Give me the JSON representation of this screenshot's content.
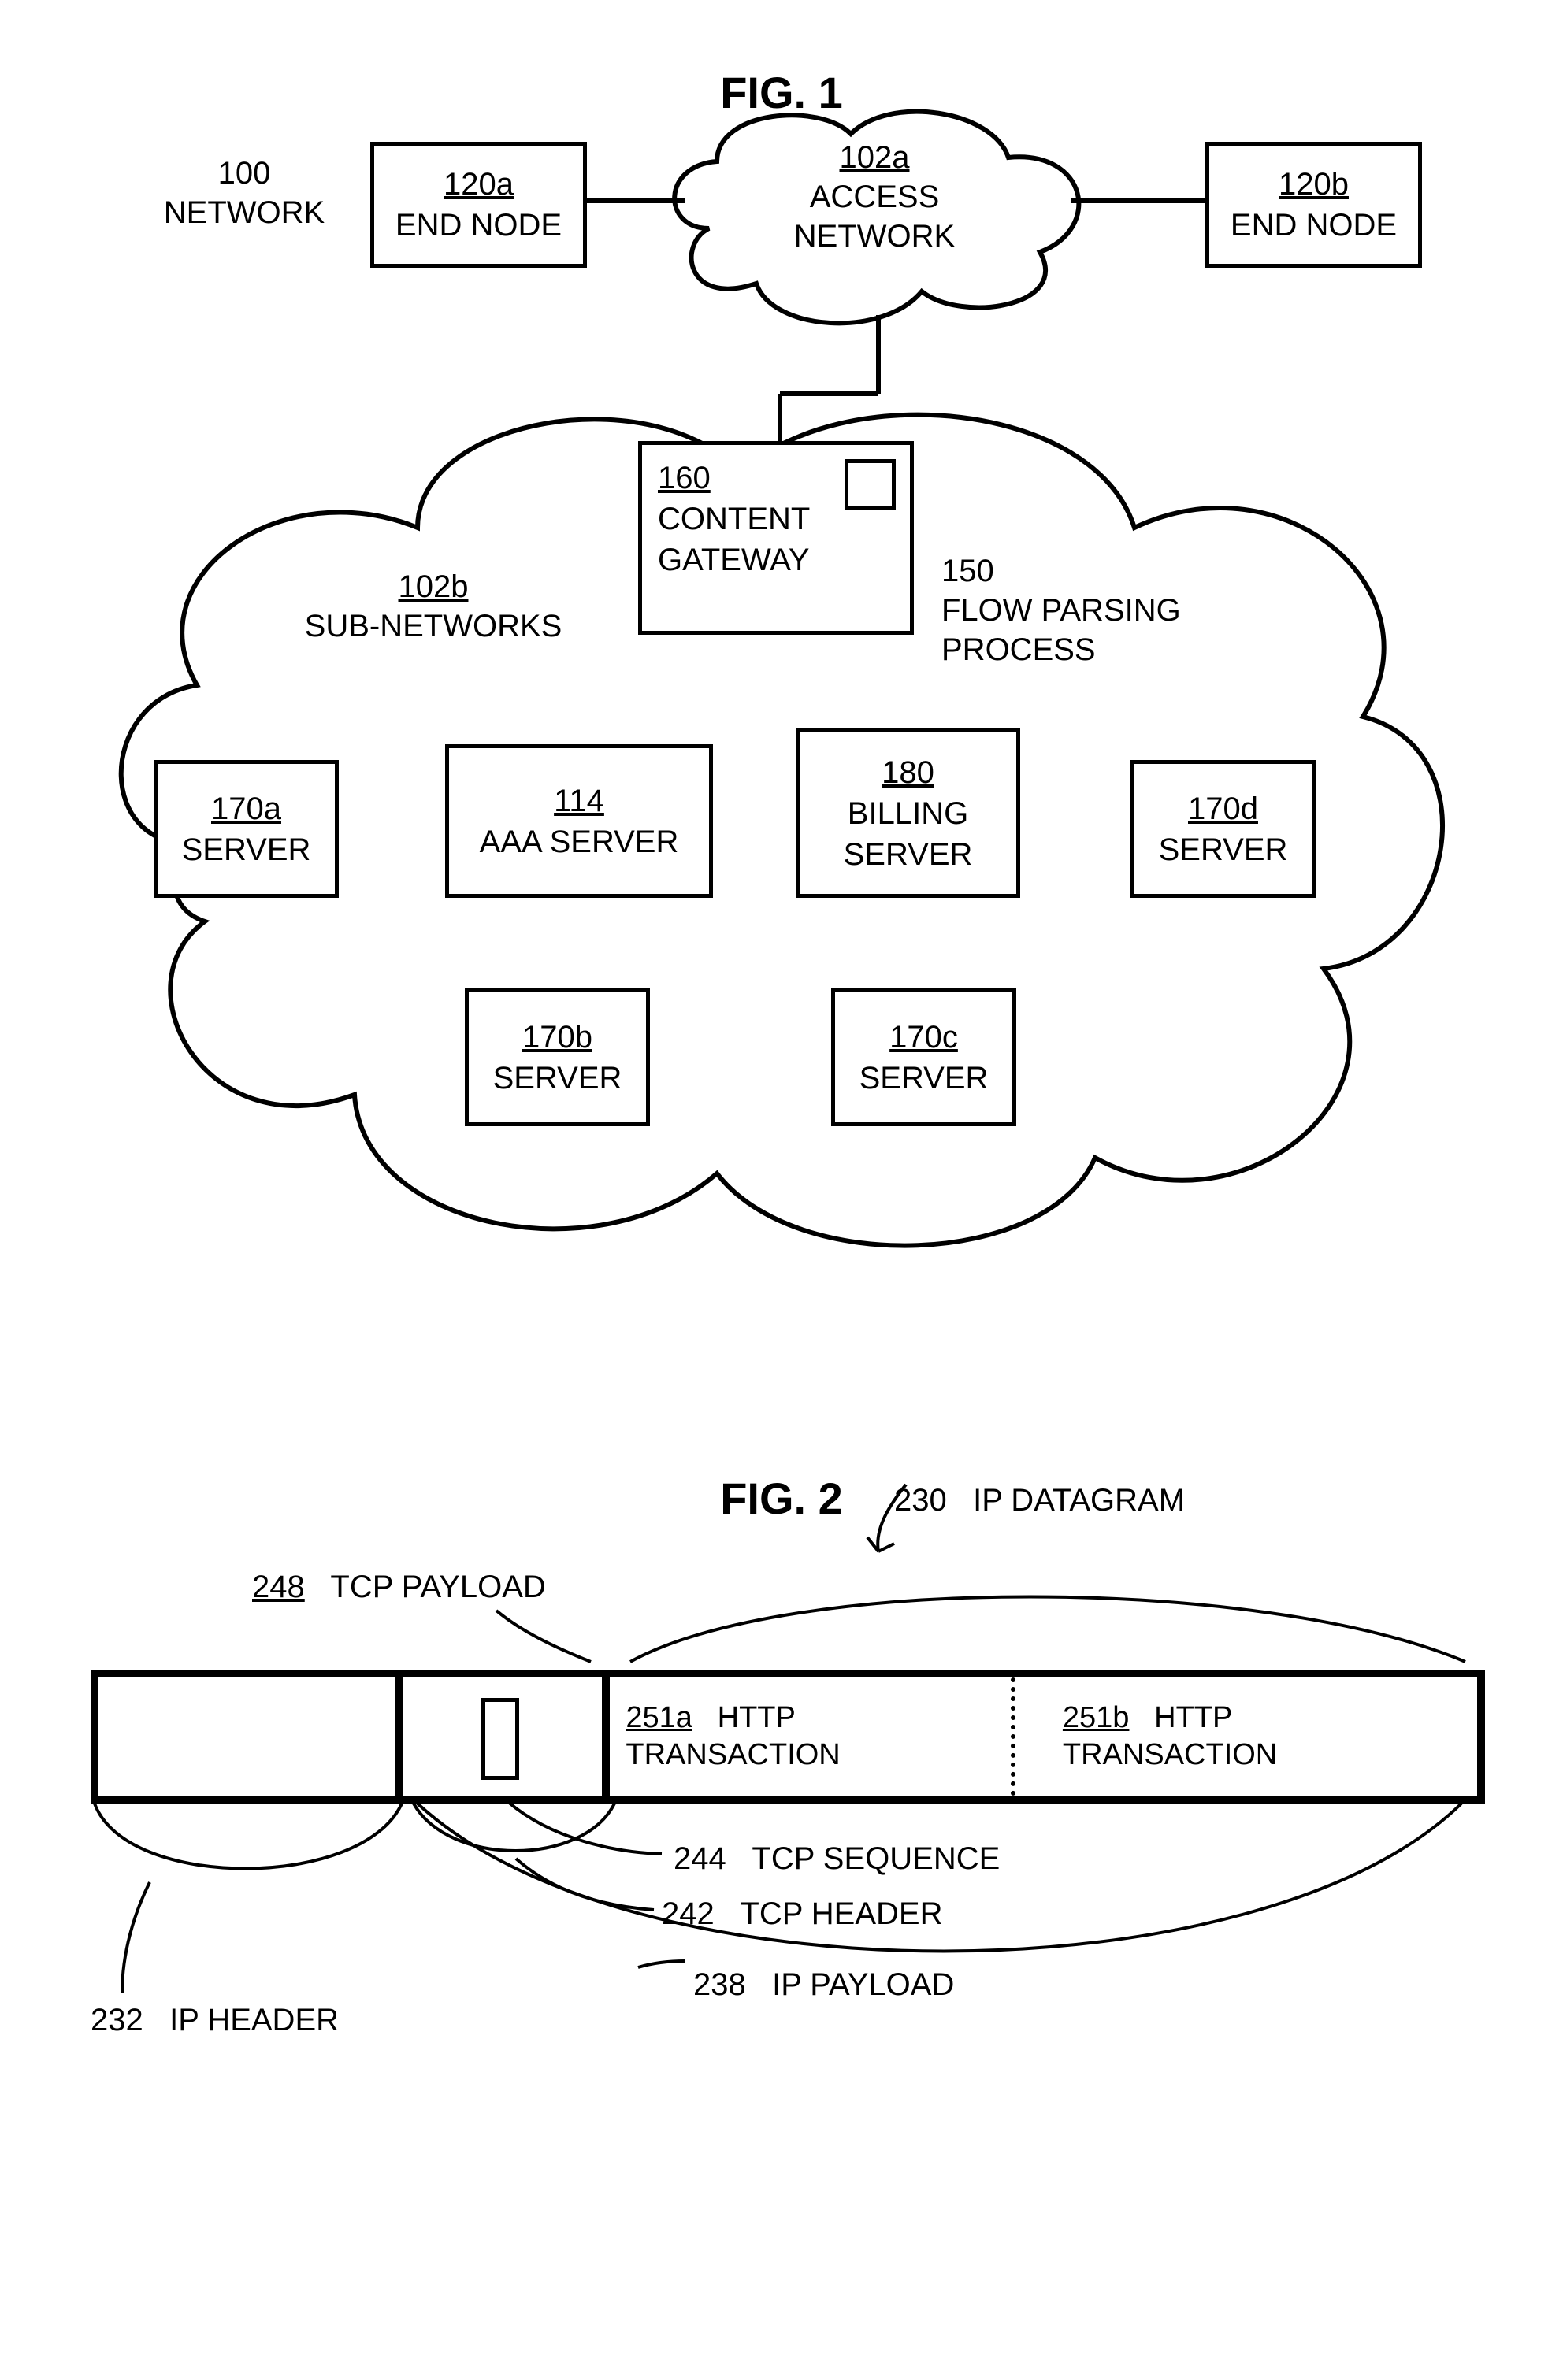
{
  "fig1": {
    "title": "FIG. 1",
    "network": {
      "id": "100",
      "label": "NETWORK"
    },
    "end_node_a": {
      "id": "120a",
      "label": "END NODE"
    },
    "end_node_b": {
      "id": "120b",
      "label": "END NODE"
    },
    "access_net": {
      "id": "102a",
      "label": "ACCESS",
      "label2": "NETWORK"
    },
    "content_gw": {
      "id": "160",
      "label": "CONTENT",
      "label2": "GATEWAY"
    },
    "flow_parse": {
      "id": "150",
      "label": "FLOW PARSING",
      "label2": "PROCESS"
    },
    "subnets": {
      "id": "102b",
      "label": "SUB-NETWORKS"
    },
    "server_a": {
      "id": "170a",
      "label": "SERVER"
    },
    "server_b": {
      "id": "170b",
      "label": "SERVER"
    },
    "server_c": {
      "id": "170c",
      "label": "SERVER"
    },
    "server_d": {
      "id": "170d",
      "label": "SERVER"
    },
    "aaa": {
      "id": "114",
      "label": "AAA SERVER"
    },
    "billing": {
      "id": "180",
      "label": "BILLING",
      "label2": "SERVER"
    }
  },
  "fig2": {
    "title": "FIG. 2",
    "ip_datagram": {
      "id": "230",
      "label": "IP DATAGRAM"
    },
    "tcp_payload": {
      "id": "248",
      "label": "TCP PAYLOAD"
    },
    "http_a": {
      "id": "251a",
      "label": "HTTP",
      "label2": "TRANSACTION"
    },
    "http_b": {
      "id": "251b",
      "label": "HTTP",
      "label2": "TRANSACTION"
    },
    "tcp_sequence": {
      "id": "244",
      "label": "TCP SEQUENCE"
    },
    "tcp_header": {
      "id": "242",
      "label": "TCP HEADER"
    },
    "ip_header": {
      "id": "232",
      "label": "IP HEADER"
    },
    "ip_payload": {
      "id": "238",
      "label": "IP PAYLOAD"
    }
  }
}
